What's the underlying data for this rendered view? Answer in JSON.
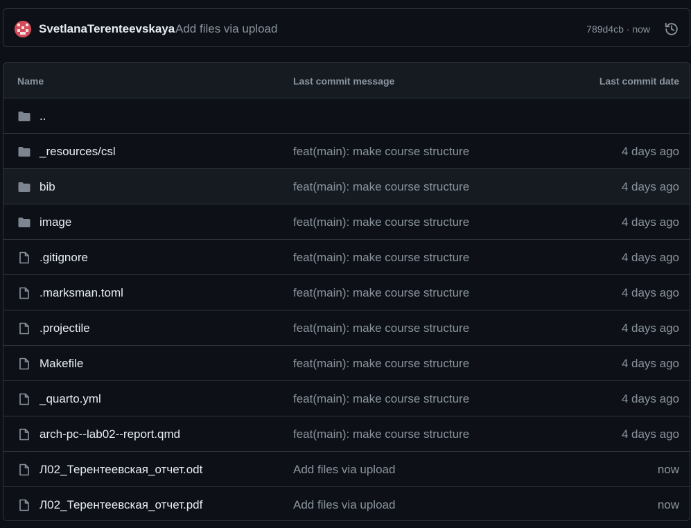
{
  "latest_commit": {
    "author": "SvetlanaTerenteevskaya",
    "message": "Add files via upload",
    "sha_time": "789d4cb · now",
    "history_icon": "history-icon",
    "avatar_color": "#d24b5a"
  },
  "table": {
    "headers": {
      "name": "Name",
      "message": "Last commit message",
      "date": "Last commit date"
    },
    "rows": [
      {
        "type": "folder",
        "icon": "folder-icon",
        "name": "..",
        "message": "",
        "date": ""
      },
      {
        "type": "folder",
        "icon": "folder-icon",
        "name": "_resources/csl",
        "message": "feat(main): make course structure",
        "date": "4 days ago"
      },
      {
        "type": "folder",
        "icon": "folder-icon",
        "name": "bib",
        "message": "feat(main): make course structure",
        "date": "4 days ago"
      },
      {
        "type": "folder",
        "icon": "folder-icon",
        "name": "image",
        "message": "feat(main): make course structure",
        "date": "4 days ago"
      },
      {
        "type": "file",
        "icon": "file-icon",
        "name": ".gitignore",
        "message": "feat(main): make course structure",
        "date": "4 days ago"
      },
      {
        "type": "file",
        "icon": "file-icon",
        "name": ".marksman.toml",
        "message": "feat(main): make course structure",
        "date": "4 days ago"
      },
      {
        "type": "file",
        "icon": "file-icon",
        "name": ".projectile",
        "message": "feat(main): make course structure",
        "date": "4 days ago"
      },
      {
        "type": "file",
        "icon": "file-icon",
        "name": "Makefile",
        "message": "feat(main): make course structure",
        "date": "4 days ago"
      },
      {
        "type": "file",
        "icon": "file-icon",
        "name": "_quarto.yml",
        "message": "feat(main): make course structure",
        "date": "4 days ago"
      },
      {
        "type": "file",
        "icon": "file-icon",
        "name": "arch-pc--lab02--report.qmd",
        "message": "feat(main): make course structure",
        "date": "4 days ago"
      },
      {
        "type": "file",
        "icon": "file-icon",
        "name": "Л02_Терентеевская_отчет.odt",
        "message": "Add files via upload",
        "date": "now"
      },
      {
        "type": "file",
        "icon": "file-icon",
        "name": "Л02_Терентеевская_отчет.pdf",
        "message": "Add files via upload",
        "date": "now"
      }
    ]
  },
  "colors": {
    "background": "#0d1117",
    "header_bg": "#161b22",
    "border": "#30363d",
    "text": "#e6edf3",
    "muted": "#8b949e",
    "folder": "#7d8590"
  }
}
